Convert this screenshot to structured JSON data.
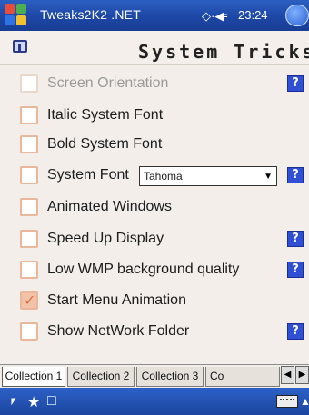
{
  "titlebar": {
    "app_title": "Tweaks2K2 .NET",
    "status_icons": "◇·◀⹀",
    "clock": "23:24",
    "ok_label": ""
  },
  "header": {
    "page_title": "System Tricks"
  },
  "options": [
    {
      "label": "Screen Orientation",
      "checked": false,
      "dim": true,
      "help": "?"
    },
    {
      "label": "Italic System Font",
      "checked": false,
      "dim": false,
      "help": ""
    },
    {
      "label": "Bold System Font",
      "checked": false,
      "dim": false,
      "help": ""
    },
    {
      "label": "System Font",
      "checked": false,
      "dim": false,
      "help": "?"
    },
    {
      "label": "Animated Windows",
      "checked": false,
      "dim": false,
      "help": ""
    },
    {
      "label": "Speed Up Display",
      "checked": false,
      "dim": false,
      "help": "?"
    },
    {
      "label": "Low WMP background quality",
      "checked": false,
      "dim": false,
      "help": "?"
    },
    {
      "label": "Start Menu Animation",
      "checked": true,
      "dim": false,
      "help": ""
    },
    {
      "label": "Show NetWork Folder",
      "checked": false,
      "dim": false,
      "help": "?"
    }
  ],
  "font_select": {
    "value": "Tahoma"
  },
  "tabs": [
    {
      "label": "Collection 1",
      "active": true
    },
    {
      "label": "Collection 2",
      "active": false
    },
    {
      "label": "Collection 3",
      "active": false
    },
    {
      "label": "Co",
      "active": false
    }
  ],
  "tab_arrows": {
    "left": "◀",
    "right": "▶"
  },
  "taskbar": {
    "icons": [
      "network-icon",
      "bluetooth-icon",
      "app-icon"
    ]
  },
  "colors": {
    "titlebar_blue": "#1d47a6",
    "help_blue": "#2f4fd4",
    "checkbox_border": "#e9b79a"
  }
}
